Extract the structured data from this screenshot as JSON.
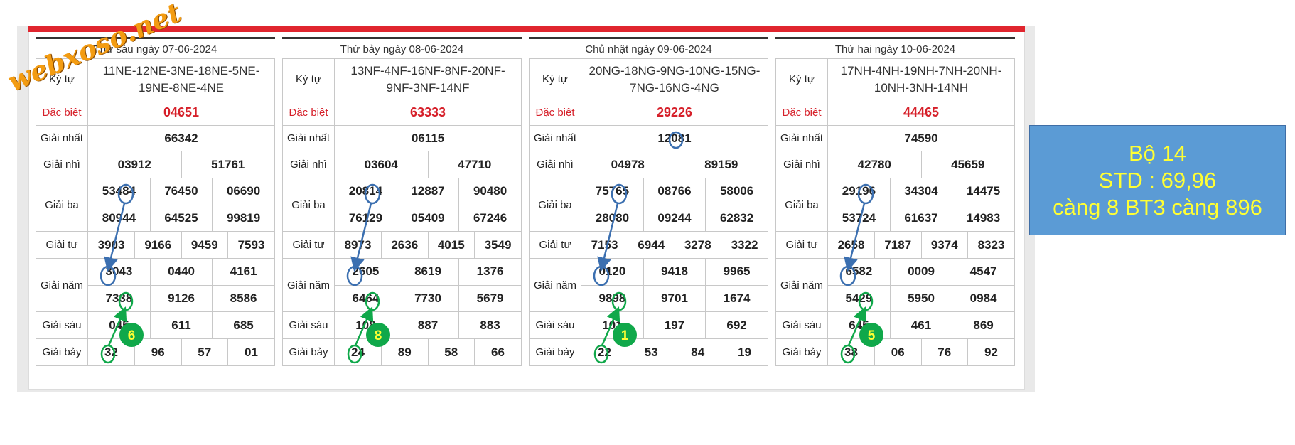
{
  "watermark": "webxoso.net",
  "info": {
    "line1": "Bộ 14",
    "line2": "STD : 69,96",
    "line3": "càng 8 BT3 càng 896"
  },
  "labels": {
    "kytu": "Ký tự",
    "db": "Đặc biệt",
    "g1": "Giải nhất",
    "g2": "Giải nhì",
    "g3": "Giải ba",
    "g4": "Giải tư",
    "g5": "Giải năm",
    "g6": "Giải sáu",
    "g7": "Giải bảy"
  },
  "cards": [
    {
      "title": "Thứ sáu ngày 07-06-2024",
      "kytu": "11NE-12NE-3NE-18NE-5NE-19NE-8NE-4NE",
      "db": "04651",
      "g1": "66342",
      "g2": [
        "03912",
        "51761"
      ],
      "g3": [
        "53484",
        "76450",
        "06690",
        "80944",
        "64525",
        "99819"
      ],
      "g4": [
        "3903",
        "9166",
        "9459",
        "7593"
      ],
      "g5": [
        "3043",
        "0440",
        "4161",
        "7338",
        "9126",
        "8586"
      ],
      "g6": [
        "045",
        "611",
        "685"
      ],
      "g7": [
        "32",
        "96",
        "57",
        "01"
      ],
      "badge": "6"
    },
    {
      "title": "Thứ bảy ngày 08-06-2024",
      "kytu": "13NF-4NF-16NF-8NF-20NF-9NF-3NF-14NF",
      "db": "63333",
      "g1": "06115",
      "g2": [
        "03604",
        "47710"
      ],
      "g3": [
        "20814",
        "12887",
        "90480",
        "76129",
        "05409",
        "67246"
      ],
      "g4": [
        "8973",
        "2636",
        "4015",
        "3549"
      ],
      "g5": [
        "2605",
        "8619",
        "1376",
        "6464",
        "7730",
        "5679"
      ],
      "g6": [
        "108",
        "887",
        "883"
      ],
      "g7": [
        "24",
        "89",
        "58",
        "66"
      ],
      "badge": "8"
    },
    {
      "title": "Chủ nhật ngày 09-06-2024",
      "kytu": "20NG-18NG-9NG-10NG-15NG-7NG-16NG-4NG",
      "db": "29226",
      "g1": "12081",
      "g2": [
        "04978",
        "89159"
      ],
      "g3": [
        "75765",
        "08766",
        "58006",
        "28080",
        "09244",
        "62832"
      ],
      "g4": [
        "7153",
        "6944",
        "3278",
        "3322"
      ],
      "g5": [
        "0120",
        "9418",
        "9965",
        "9898",
        "9701",
        "1674"
      ],
      "g6": [
        "101",
        "197",
        "692"
      ],
      "g7": [
        "22",
        "53",
        "84",
        "19"
      ],
      "badge": "1"
    },
    {
      "title": "Thứ hai ngày 10-06-2024",
      "kytu": "17NH-4NH-19NH-7NH-20NH-10NH-3NH-14NH",
      "db": "44465",
      "g1": "74590",
      "g2": [
        "42780",
        "45659"
      ],
      "g3": [
        "29196",
        "34304",
        "14475",
        "53724",
        "61637",
        "14983"
      ],
      "g4": [
        "2658",
        "7187",
        "9374",
        "8323"
      ],
      "g5": [
        "6582",
        "0009",
        "4547",
        "5429",
        "5950",
        "0984"
      ],
      "g6": [
        "645",
        "461",
        "869"
      ],
      "g7": [
        "38",
        "06",
        "76",
        "92"
      ],
      "badge": "5"
    }
  ],
  "colors": {
    "accent_red": "#e0252e",
    "circle_blue": "#3b6fb0",
    "circle_green": "#10a84a",
    "badge_text": "#ffff33"
  }
}
